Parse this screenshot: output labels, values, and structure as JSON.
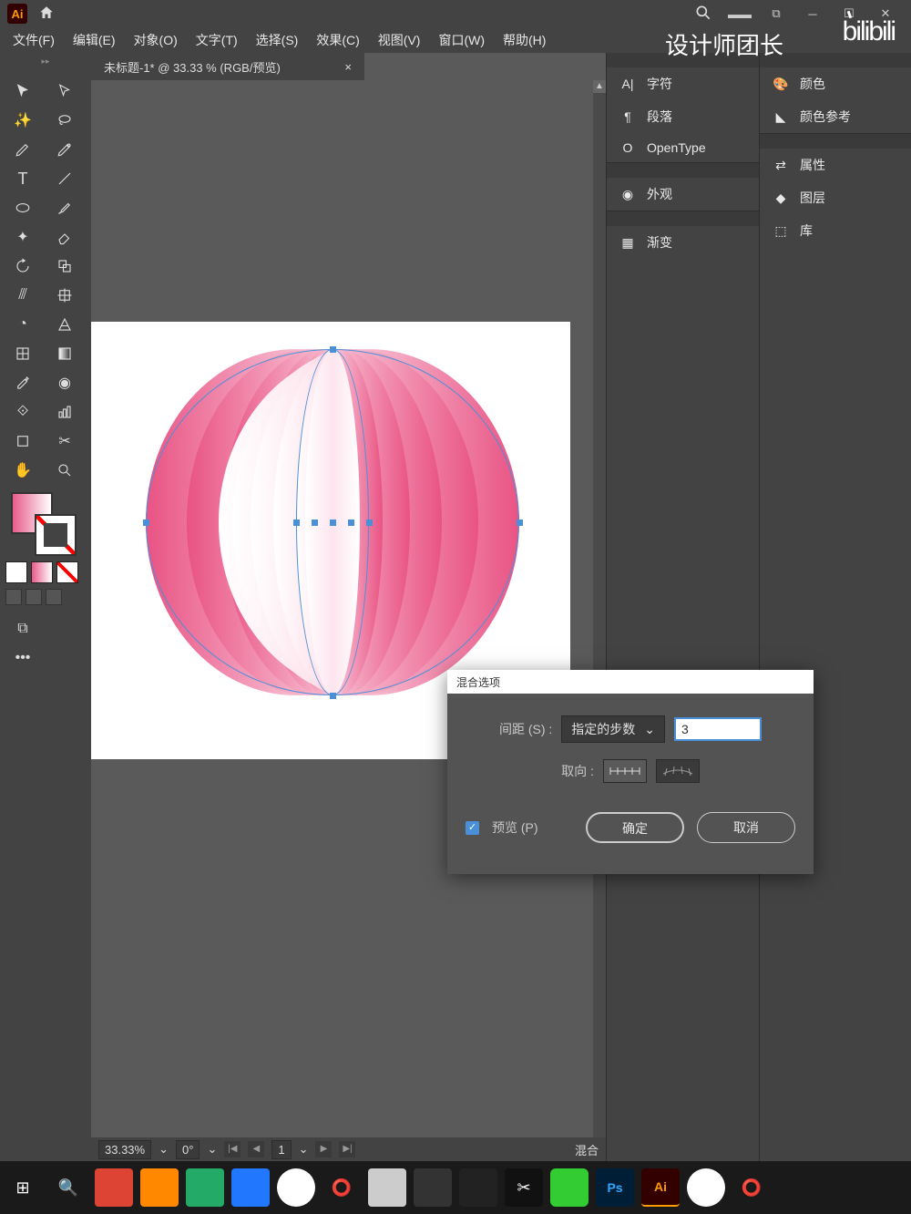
{
  "titlebar": {
    "app_abbrev": "Ai"
  },
  "menubar": {
    "file": "文件(F)",
    "edit": "编辑(E)",
    "object": "对象(O)",
    "type": "文字(T)",
    "select": "选择(S)",
    "effect": "效果(C)",
    "view": "视图(V)",
    "window": "窗口(W)",
    "help": "帮助(H)"
  },
  "overlay_text": "设计师团长",
  "overlay_brand": "bilibili",
  "doc": {
    "tab_label": "未标题-1* @ 33.33 % (RGB/预览)",
    "close": "×"
  },
  "panels": {
    "left": [
      {
        "icon": "A|",
        "label": "字符"
      },
      {
        "icon": "¶",
        "label": "段落"
      },
      {
        "icon": "O",
        "label": "OpenType"
      },
      {
        "icon": "◉",
        "label": "外观"
      },
      {
        "icon": "▦",
        "label": "渐变"
      }
    ],
    "right": [
      {
        "icon": "🎨",
        "label": "颜色"
      },
      {
        "icon": "◣",
        "label": "颜色参考"
      },
      {
        "icon": "⇄",
        "label": "属性"
      },
      {
        "icon": "◆",
        "label": "图层"
      },
      {
        "icon": "⬚",
        "label": "库"
      }
    ]
  },
  "dialog": {
    "title": "混合选项",
    "spacing_label": "间距 (S) :",
    "spacing_mode": "指定的步数",
    "spacing_value": "3",
    "orientation_label": "取向 :",
    "preview_label": "预览 (P)",
    "ok": "确定",
    "cancel": "取消"
  },
  "status": {
    "zoom": "33.33%",
    "rotate": "0°",
    "artboard": "1",
    "tool_label": "混合"
  },
  "taskbar_icons": [
    "⊞",
    "🔍",
    "🟧",
    "🟧",
    "🔵",
    "🔵",
    "🌐",
    "⭕",
    "📋",
    "⬛",
    "⬛",
    "✂",
    "💬",
    "Ps",
    "Ai",
    "🌐",
    "⭕"
  ]
}
